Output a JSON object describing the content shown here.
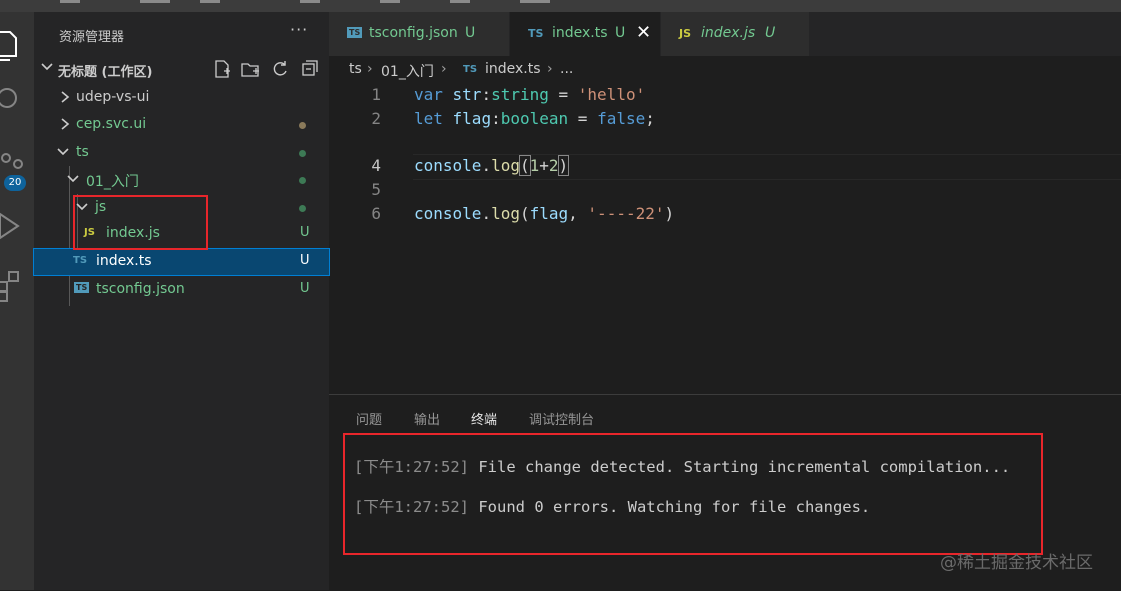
{
  "colors": {
    "untracked_green": "#73c991",
    "ts_blue": "#519aba",
    "js_yellow": "#cbcb41",
    "highlight_red": "#e8262b"
  },
  "explorer": {
    "title": "资源管理器",
    "more": "···",
    "workspace": "无标题 (工作区)",
    "tree": [
      {
        "label": "udep-vs-ui",
        "type": "folder",
        "state": "collapsed",
        "badge": ""
      },
      {
        "label": "cep.svc.ui",
        "type": "folder",
        "state": "collapsed",
        "badge": "dot"
      },
      {
        "label": "ts",
        "type": "folder",
        "state": "expanded",
        "badge": "dot"
      },
      {
        "label": "01_入门",
        "type": "folder",
        "state": "expanded",
        "badge": "dot"
      },
      {
        "label": "js",
        "type": "folder",
        "state": "expanded",
        "badge": "dot"
      },
      {
        "label": "index.js",
        "type": "file",
        "icon": "JS",
        "badge": "U"
      },
      {
        "label": "index.ts",
        "type": "file",
        "icon": "TS",
        "badge": "U",
        "selected": true
      },
      {
        "label": "tsconfig.json",
        "type": "file",
        "icon": "TS",
        "badge": "U"
      }
    ]
  },
  "activity_bar": {
    "scm_badge": "20"
  },
  "tabs": [
    {
      "label": "tsconfig.json",
      "icon": "TS",
      "status": "U"
    },
    {
      "label": "index.ts",
      "icon": "TS",
      "status": "U",
      "active": true,
      "close": "✕"
    },
    {
      "label": "index.js",
      "icon": "JS",
      "status": "U"
    }
  ],
  "breadcrumb": {
    "p1": "ts",
    "sep": "›",
    "p2": "01_入门",
    "icon": "TS",
    "p3": "index.ts",
    "p4": "..."
  },
  "code": {
    "line_numbers": [
      "1",
      "2",
      "4",
      "5",
      "6"
    ],
    "lines": [
      {
        "t1": "var",
        "t2": " str",
        "t3": ":",
        "t4": "string",
        "t5": " = ",
        "t6": "'hello'"
      },
      {
        "t1": "let",
        "t2": " flag",
        "t3": ":",
        "t4": "boolean",
        "t5": " = ",
        "t6": "false",
        "t7": ";"
      },
      {
        "t1": "console",
        "t2": ".",
        "t3": "log",
        "t4": "(",
        "t5": "1",
        "t6": "+",
        "t7": "2",
        "t8": ")"
      },
      {
        "t1": "console",
        "t2": ".",
        "t3": "log",
        "t4": "(",
        "t5": "flag",
        "t6": ", ",
        "t7": "'----22'",
        "t8": ")"
      }
    ]
  },
  "panel": {
    "tabs": [
      "问题",
      "输出",
      "终端",
      "调试控制台"
    ],
    "active_tab": "终端",
    "terminal": [
      {
        "ts": "[下午1:27:52]",
        "msg": " File change detected. Starting incremental compilation..."
      },
      {
        "ts": "[下午1:27:52]",
        "msg": " Found 0 errors. Watching for file changes."
      }
    ]
  },
  "watermark": "@稀土掘金技术社区"
}
